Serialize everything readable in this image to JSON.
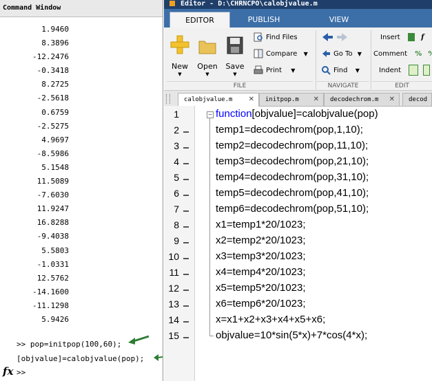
{
  "command_window": {
    "title": "Command Window",
    "output_values": [
      "1.9460",
      "8.3896",
      "-12.2476",
      "-0.3418",
      "8.2725",
      "-2.5618",
      "0.6759",
      "-2.5275",
      "4.9697",
      "-8.5986",
      "5.1548",
      "11.5089",
      "-7.6030",
      "11.9247",
      "16.8288",
      "-9.4038",
      "5.5803",
      "-1.0331",
      "12.5762",
      "-14.1600",
      "-11.1298",
      "5.9426"
    ],
    "commands": [
      ">> pop=initpop(100,60);",
      "[objvalue]=calobjvalue(pop);"
    ],
    "prompt": ">>",
    "fx_icon": "fx-icon",
    "arrow_color": "#2e7d32"
  },
  "editor": {
    "title": "Editor - D:\\CHRNCPO\\calobjvalue.m",
    "tabs": [
      "EDITOR",
      "PUBLISH",
      "VIEW"
    ],
    "ribbon": {
      "new": "New",
      "open": "Open",
      "save": "Save",
      "find_files": "Find Files",
      "compare": "Compare",
      "print": "Print",
      "go_to": "Go To",
      "find": "Find",
      "insert": "Insert",
      "comment": "Comment",
      "indent": "Indent",
      "sections": {
        "file": "FILE",
        "navigate": "NAVIGATE",
        "edit": "EDIT"
      }
    },
    "doc_tabs": [
      "calobjvalue.m",
      "initpop.m",
      "decodechrom.m",
      "decod"
    ],
    "code_lines": [
      {
        "n": "1",
        "kw": "function",
        "text": "[objvalue]=calobjvalue(pop)"
      },
      {
        "n": "2",
        "kw": "",
        "text": "temp1=decodechrom(pop,1,10);"
      },
      {
        "n": "3",
        "kw": "",
        "text": "temp2=decodechrom(pop,11,10);"
      },
      {
        "n": "4",
        "kw": "",
        "text": "temp3=decodechrom(pop,21,10);"
      },
      {
        "n": "5",
        "kw": "",
        "text": "temp4=decodechrom(pop,31,10);"
      },
      {
        "n": "6",
        "kw": "",
        "text": "temp5=decodechrom(pop,41,10);"
      },
      {
        "n": "7",
        "kw": "",
        "text": "temp6=decodechrom(pop,51,10);"
      },
      {
        "n": "8",
        "kw": "",
        "text": "x1=temp1*20/1023;"
      },
      {
        "n": "9",
        "kw": "",
        "text": "x2=temp2*20/1023;"
      },
      {
        "n": "10",
        "kw": "",
        "text": "x3=temp3*20/1023;"
      },
      {
        "n": "11",
        "kw": "",
        "text": "x4=temp4*20/1023;"
      },
      {
        "n": "12",
        "kw": "",
        "text": "x5=temp5*20/1023;"
      },
      {
        "n": "13",
        "kw": "",
        "text": "x6=temp6*20/1023;"
      },
      {
        "n": "14",
        "kw": "",
        "text": "x=x1+x2+x3+x4+x5+x6;"
      },
      {
        "n": "15",
        "kw": "",
        "text": "objvalue=10*sin(5*x)+7*cos(4*x);"
      }
    ],
    "colors": {
      "keyword": "#0000ff",
      "tabbar": "#3c6fa8",
      "titlebar": "#1f3f6a"
    }
  }
}
